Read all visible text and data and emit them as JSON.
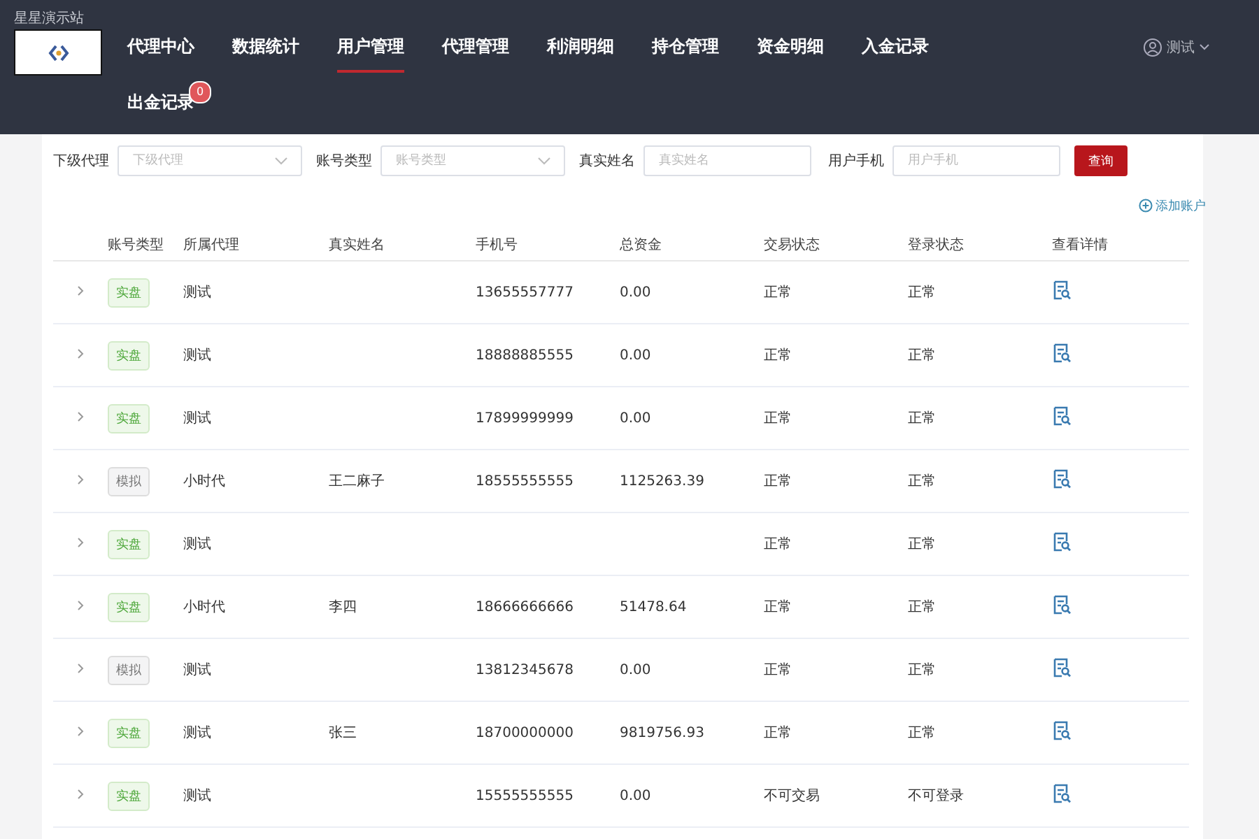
{
  "site_title": "星星演示站",
  "nav": [
    {
      "label": "代理中心",
      "selected": false
    },
    {
      "label": "数据统计",
      "selected": false
    },
    {
      "label": "用户管理",
      "selected": true
    },
    {
      "label": "代理管理",
      "selected": false
    },
    {
      "label": "利润明细",
      "selected": false
    },
    {
      "label": "持仓管理",
      "selected": false
    },
    {
      "label": "资金明细",
      "selected": false
    },
    {
      "label": "入金记录",
      "selected": false
    },
    {
      "label": "出金记录",
      "selected": false,
      "badge": "0"
    }
  ],
  "user": {
    "name": "测试"
  },
  "filters": [
    {
      "label": "下级代理",
      "kind": "select",
      "placeholder": "下级代理"
    },
    {
      "label": "账号类型",
      "kind": "select",
      "placeholder": "账号类型"
    },
    {
      "label": "真实姓名",
      "kind": "input",
      "placeholder": "真实姓名"
    },
    {
      "label": "用户手机",
      "kind": "input",
      "placeholder": "用户手机"
    }
  ],
  "search_button": "查询",
  "add_account": "添加账户",
  "table": {
    "columns": [
      "账号类型",
      "所属代理",
      "真实姓名",
      "手机号",
      "总资金",
      "交易状态",
      "登录状态",
      "查看详情"
    ],
    "rows": [
      {
        "type": {
          "label": "实盘",
          "kind": "real"
        },
        "agent": "测试",
        "name": "",
        "phone": "13655557777",
        "total": "0.00",
        "trade": "正常",
        "login": "正常"
      },
      {
        "type": {
          "label": "实盘",
          "kind": "real"
        },
        "agent": "测试",
        "name": "",
        "phone": "18888885555",
        "total": "0.00",
        "trade": "正常",
        "login": "正常"
      },
      {
        "type": {
          "label": "实盘",
          "kind": "real"
        },
        "agent": "测试",
        "name": "",
        "phone": "17899999999",
        "total": "0.00",
        "trade": "正常",
        "login": "正常"
      },
      {
        "type": {
          "label": "模拟",
          "kind": "sim"
        },
        "agent": "小时代",
        "name": "王二麻子",
        "phone": "18555555555",
        "total": "1125263.39",
        "trade": "正常",
        "login": "正常"
      },
      {
        "type": {
          "label": "实盘",
          "kind": "real"
        },
        "agent": "测试",
        "name": "",
        "phone": "",
        "total": "",
        "trade": "正常",
        "login": "正常"
      },
      {
        "type": {
          "label": "实盘",
          "kind": "real"
        },
        "agent": "小时代",
        "name": "李四",
        "phone": "18666666666",
        "total": "51478.64",
        "trade": "正常",
        "login": "正常"
      },
      {
        "type": {
          "label": "模拟",
          "kind": "sim"
        },
        "agent": "测试",
        "name": "",
        "phone": "13812345678",
        "total": "0.00",
        "trade": "正常",
        "login": "正常"
      },
      {
        "type": {
          "label": "实盘",
          "kind": "real"
        },
        "agent": "测试",
        "name": "张三",
        "phone": "18700000000",
        "total": "9819756.93",
        "trade": "正常",
        "login": "正常"
      },
      {
        "type": {
          "label": "实盘",
          "kind": "real"
        },
        "agent": "测试",
        "name": "",
        "phone": "15555555555",
        "total": "0.00",
        "trade": "不可交易",
        "login": "不可登录"
      }
    ]
  }
}
